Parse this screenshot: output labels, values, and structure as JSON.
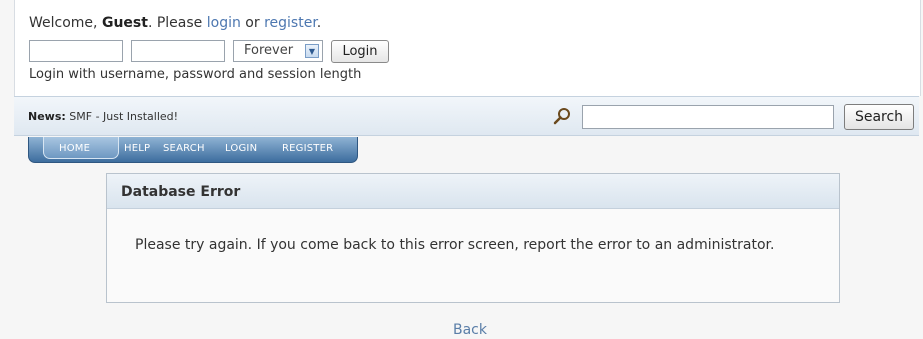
{
  "user": {
    "welcome_prefix": "Welcome,",
    "username": "Guest",
    "please": ". Please",
    "login_link": "login",
    "or": "or",
    "register_link": "register",
    "period": ".",
    "session_value": "Forever",
    "login_button": "Login",
    "login_help": "Login with username, password and session length"
  },
  "news": {
    "label": "News:",
    "text": "SMF - Just Installed!"
  },
  "search": {
    "button": "Search",
    "icon": "magnifier-icon"
  },
  "menu": {
    "items": [
      "HOME",
      "HELP",
      "SEARCH",
      "LOGIN",
      "REGISTER"
    ]
  },
  "error": {
    "title": "Database Error",
    "message": "Please try again. If you come back to this error screen, report the error to an administrator."
  },
  "back_link": "Back",
  "colors": {
    "link": "#4d77b0",
    "menu_bg": "#3d6d9e",
    "news_bar": "#dfe8f1"
  }
}
